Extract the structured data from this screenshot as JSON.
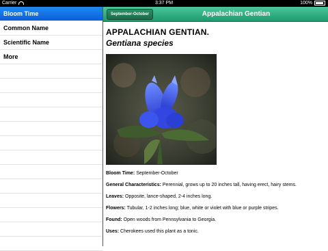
{
  "status_bar": {
    "carrier": "Carrier",
    "time": "3:37 PM",
    "battery": "100%"
  },
  "sidebar": {
    "items": [
      {
        "label": "Bloom Time",
        "selected": true
      },
      {
        "label": "Common Name",
        "selected": false
      },
      {
        "label": "Scientific Name",
        "selected": false
      },
      {
        "label": "More",
        "selected": false
      }
    ]
  },
  "navbar": {
    "back_button_label": "September-October",
    "title": "Appalachian Gentian"
  },
  "detail": {
    "title": "APPALACHIAN GENTIAN.",
    "scientific_name": "Gentiana species",
    "fields": [
      {
        "label": "Bloom Time:",
        "value": "September-October"
      },
      {
        "label": "General Characteristics:",
        "value": "Perennial, grows up to 20 inches tall, having erect, hairy stems."
      },
      {
        "label": "Leaves:",
        "value": "Opposite, lance-shaped, 2-4 inches long."
      },
      {
        "label": "Flowers:",
        "value": "Tubular, 1-2 inches long; blue, white or violet with blue or purple stripes."
      },
      {
        "label": "Found:",
        "value": "Open woods from Pennsylvania to Georgia."
      },
      {
        "label": "Uses:",
        "value": "Cherokees used this plant as a tonic."
      }
    ]
  },
  "colors": {
    "navbar_accent": "#2aa87b",
    "selected_row": "#1877e8"
  }
}
